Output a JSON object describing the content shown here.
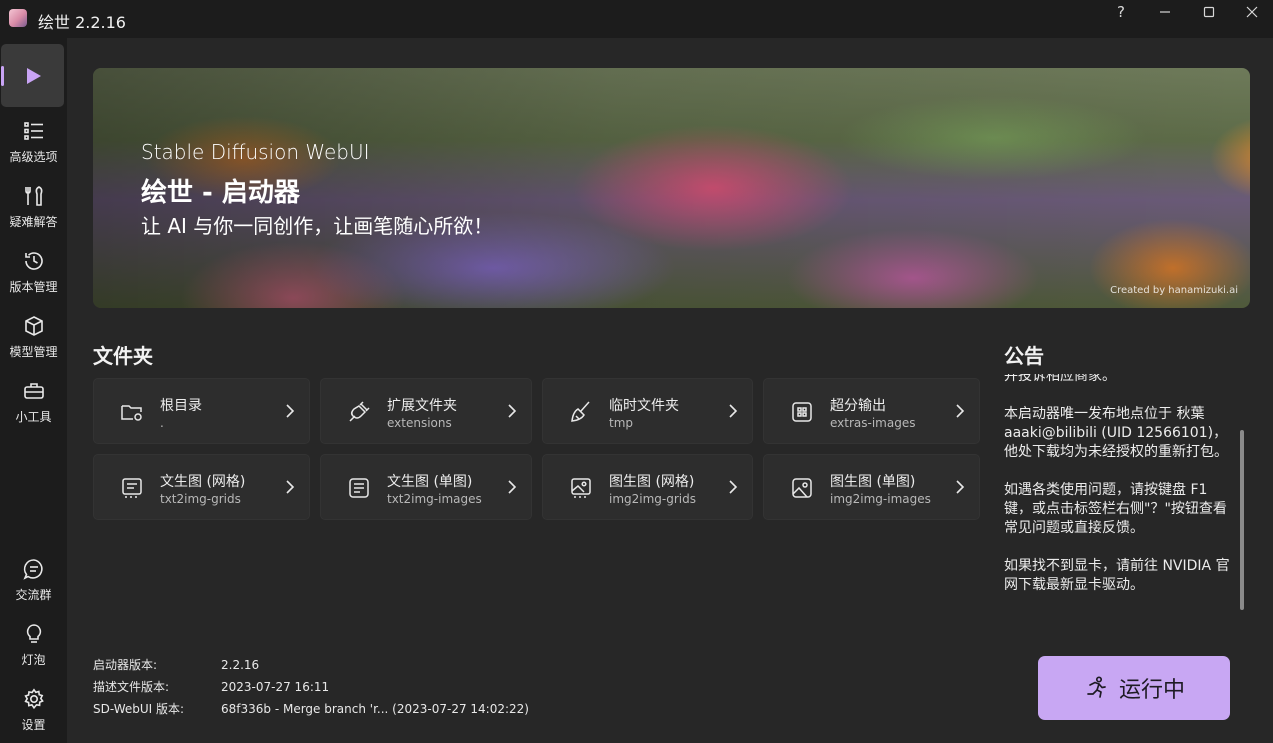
{
  "window": {
    "title": "绘世 2.2.16",
    "help_glyph": "?",
    "minimize_glyph": "—",
    "maximize_glyph": "□",
    "close_glyph": "✕"
  },
  "sidebar": {
    "items": [
      {
        "label": "",
        "icon": "play-icon"
      },
      {
        "label": "高级选项",
        "icon": "list-settings-icon"
      },
      {
        "label": "疑难解答",
        "icon": "tools-icon"
      },
      {
        "label": "版本管理",
        "icon": "history-icon"
      },
      {
        "label": "模型管理",
        "icon": "cube-icon"
      },
      {
        "label": "小工具",
        "icon": "toolbox-icon"
      },
      {
        "label": "交流群",
        "icon": "chat-icon"
      },
      {
        "label": "灯泡",
        "icon": "lightbulb-icon"
      },
      {
        "label": "设置",
        "icon": "gear-icon"
      }
    ]
  },
  "banner": {
    "subtitle": "Stable Diffusion WebUI",
    "title": "绘世 - 启动器",
    "tagline": "让 AI 与你一同创作，让画笔随心所欲！",
    "credit": "Created by hanamizuki.ai"
  },
  "folders": {
    "title": "文件夹",
    "items": [
      {
        "name": "根目录",
        "path": ".",
        "icon": "folder-settings-icon"
      },
      {
        "name": "扩展文件夹",
        "path": "extensions",
        "icon": "plug-icon"
      },
      {
        "name": "临时文件夹",
        "path": "tmp",
        "icon": "broom-icon"
      },
      {
        "name": "超分输出",
        "path": "extras-images",
        "icon": "upscale-icon"
      },
      {
        "name": "文生图 (网格)",
        "path": "txt2img-grids",
        "icon": "text-grid-icon"
      },
      {
        "name": "文生图 (单图)",
        "path": "txt2img-images",
        "icon": "text-doc-icon"
      },
      {
        "name": "图生图 (网格)",
        "path": "img2img-grids",
        "icon": "image-grid-icon"
      },
      {
        "name": "图生图 (单图)",
        "path": "img2img-images",
        "icon": "image-icon"
      }
    ]
  },
  "notice": {
    "title": "公告",
    "paragraphs": [
      "并投诉相应商家。",
      "本启动器唯一发布地点位于 秋葉aaaki@bilibili (UID 12566101)，他处下载均为未经授权的重新打包。",
      "如遇各类使用问题，请按键盘 F1 键，或点击标签栏右侧\"？\"按钮查看常见问题或直接反馈。",
      "如果找不到显卡，请前往 NVIDIA 官网下载最新显卡驱动。"
    ]
  },
  "versions": [
    {
      "key": "启动器版本:",
      "value": "2.2.16"
    },
    {
      "key": "描述文件版本:",
      "value": "2023-07-27 16:11"
    },
    {
      "key": "SD-WebUI 版本:",
      "value": "68f336b - Merge branch 'r... (2023-07-27 14:02:22)"
    }
  ],
  "run_button": {
    "label": "运行中",
    "icon": "running-person-icon"
  },
  "colors": {
    "accent": "#c8a7f3",
    "background": "#272727",
    "sidebar": "#1c1c1c",
    "card": "#2d2d2d"
  }
}
